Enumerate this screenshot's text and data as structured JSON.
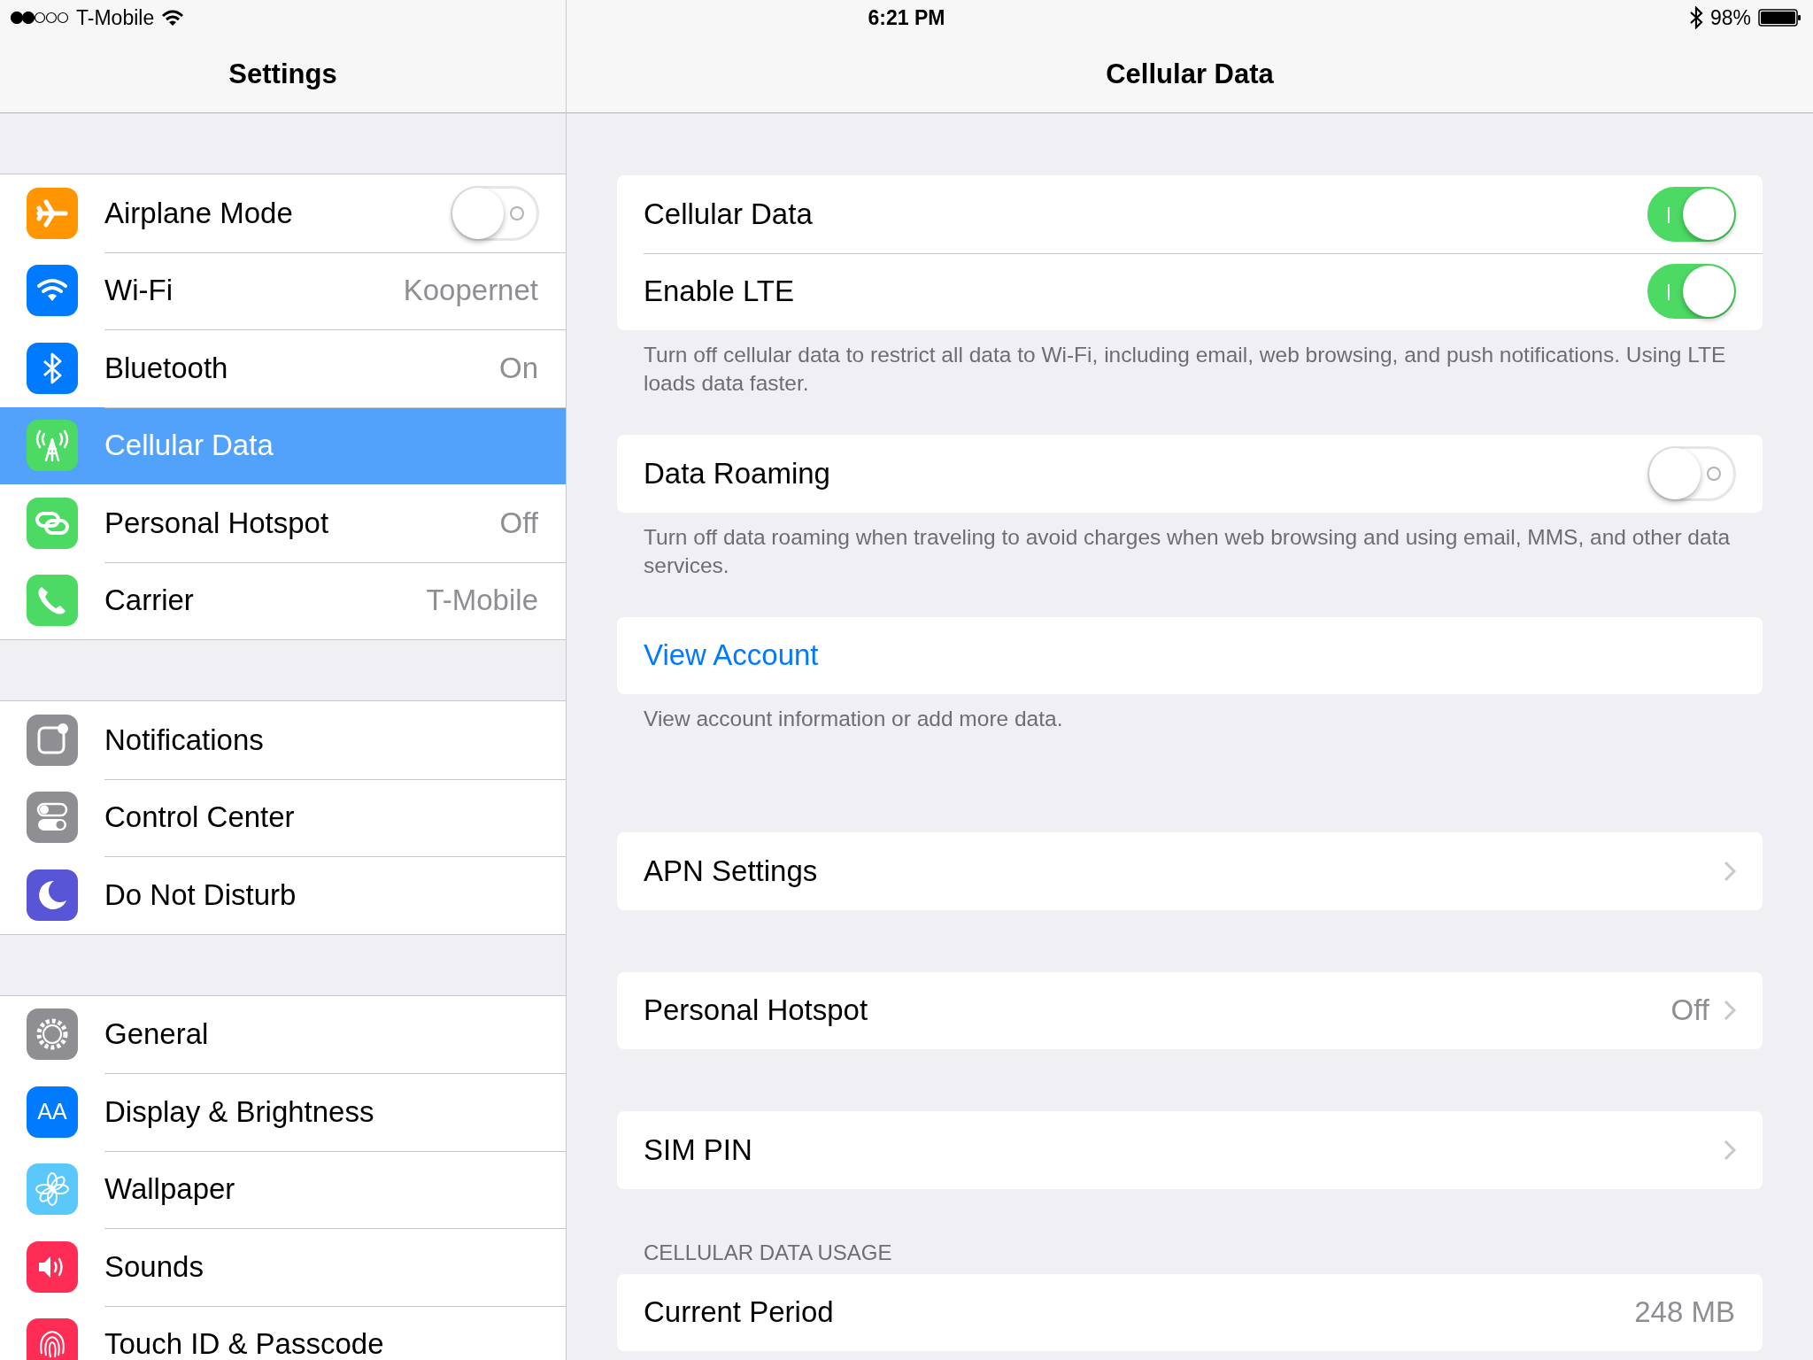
{
  "status_bar": {
    "carrier": "T-Mobile",
    "time": "6:21 PM",
    "battery": "98%"
  },
  "sidebar": {
    "title": "Settings",
    "groups": [
      {
        "items": [
          {
            "label": "Airplane Mode",
            "kind": "toggle",
            "on": false,
            "selected": false
          },
          {
            "label": "Wi-Fi",
            "kind": "value",
            "value": "Koopernet",
            "selected": false
          },
          {
            "label": "Bluetooth",
            "kind": "value",
            "value": "On",
            "selected": false
          },
          {
            "label": "Cellular Data",
            "kind": "value",
            "selected": true
          },
          {
            "label": "Personal Hotspot",
            "kind": "value",
            "value": "Off",
            "selected": false
          },
          {
            "label": "Carrier",
            "kind": "value",
            "value": "T-Mobile",
            "selected": false
          }
        ]
      },
      {
        "items": [
          {
            "label": "Notifications",
            "kind": "value",
            "selected": false
          },
          {
            "label": "Control Center",
            "kind": "value",
            "selected": false
          },
          {
            "label": "Do Not Disturb",
            "kind": "value",
            "selected": false
          }
        ]
      },
      {
        "items": [
          {
            "label": "General",
            "kind": "value",
            "selected": false
          },
          {
            "label": "Display & Brightness",
            "kind": "value",
            "icon_text": "AA",
            "selected": false
          },
          {
            "label": "Wallpaper",
            "kind": "value",
            "selected": false
          },
          {
            "label": "Sounds",
            "kind": "value",
            "selected": false
          },
          {
            "label": "Touch ID & Passcode",
            "kind": "value",
            "selected": false
          }
        ]
      }
    ]
  },
  "detail": {
    "title": "Cellular Data",
    "sections": [
      {
        "rows": [
          {
            "kind": "toggle",
            "label": "Cellular Data",
            "on": true
          },
          {
            "kind": "toggle",
            "label": "Enable LTE",
            "on": true
          }
        ],
        "footer": "Turn off cellular data to restrict all data to Wi-Fi, including email, web browsing, and push notifications. Using LTE loads data faster."
      },
      {
        "rows": [
          {
            "kind": "toggle",
            "label": "Data Roaming",
            "on": false
          }
        ],
        "footer": "Turn off data roaming when traveling to avoid charges when web browsing and using email, MMS, and other data services."
      },
      {
        "rows": [
          {
            "kind": "link",
            "label": "View Account"
          }
        ],
        "footer": "View account information or add more data."
      },
      {
        "rows": [
          {
            "kind": "disclosure",
            "label": "APN Settings"
          }
        ]
      },
      {
        "rows": [
          {
            "kind": "disclosure",
            "label": "Personal Hotspot",
            "value": "Off"
          }
        ]
      },
      {
        "rows": [
          {
            "kind": "disclosure",
            "label": "SIM PIN"
          }
        ]
      },
      {
        "header": "CELLULAR DATA USAGE",
        "rows": [
          {
            "kind": "value",
            "label": "Current Period",
            "value": "248 MB"
          }
        ]
      }
    ]
  }
}
